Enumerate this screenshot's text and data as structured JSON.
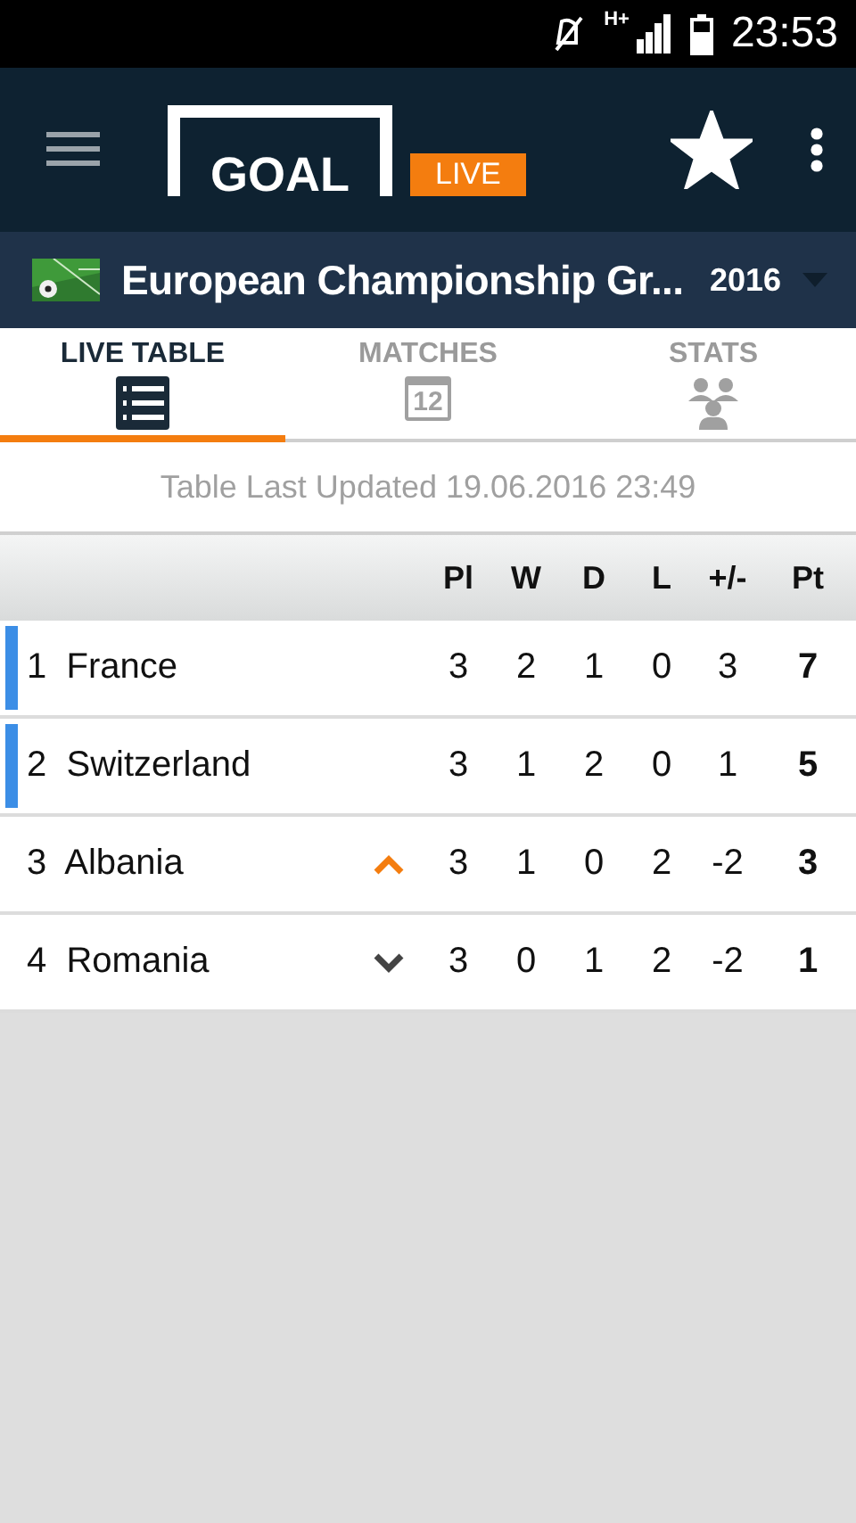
{
  "status_bar": {
    "time": "23:53",
    "network": "H+"
  },
  "header": {
    "logo_text": "GOAL",
    "logo_badge": "LIVE",
    "favorite": true
  },
  "competition": {
    "title": "European Championship Gr...",
    "season": "2016"
  },
  "tabs": [
    {
      "label": "LIVE TABLE",
      "kind": "list",
      "selected": true
    },
    {
      "label": "MATCHES",
      "kind": "calendar",
      "icon_text": "12",
      "selected": false
    },
    {
      "label": "STATS",
      "kind": "people",
      "selected": false
    }
  ],
  "updated": "Table Last Updated 19.06.2016 23:49",
  "table": {
    "columns": [
      "Pl",
      "W",
      "D",
      "L",
      "+/-",
      "Pt"
    ],
    "rows": [
      {
        "rank": "1",
        "team": "France",
        "qualified": true,
        "kind": "steady",
        "cells": [
          "3",
          "2",
          "1",
          "0",
          "3",
          "7"
        ]
      },
      {
        "rank": "2",
        "team": "Switzerland",
        "qualified": true,
        "kind": "steady",
        "cells": [
          "3",
          "1",
          "2",
          "0",
          "1",
          "5"
        ]
      },
      {
        "rank": "3",
        "team": "Albania",
        "qualified": false,
        "kind": "up",
        "cells": [
          "3",
          "1",
          "0",
          "2",
          "-2",
          "3"
        ]
      },
      {
        "rank": "4",
        "team": "Romania",
        "qualified": false,
        "kind": "down",
        "cells": [
          "3",
          "0",
          "1",
          "2",
          "-2",
          "1"
        ]
      }
    ]
  }
}
